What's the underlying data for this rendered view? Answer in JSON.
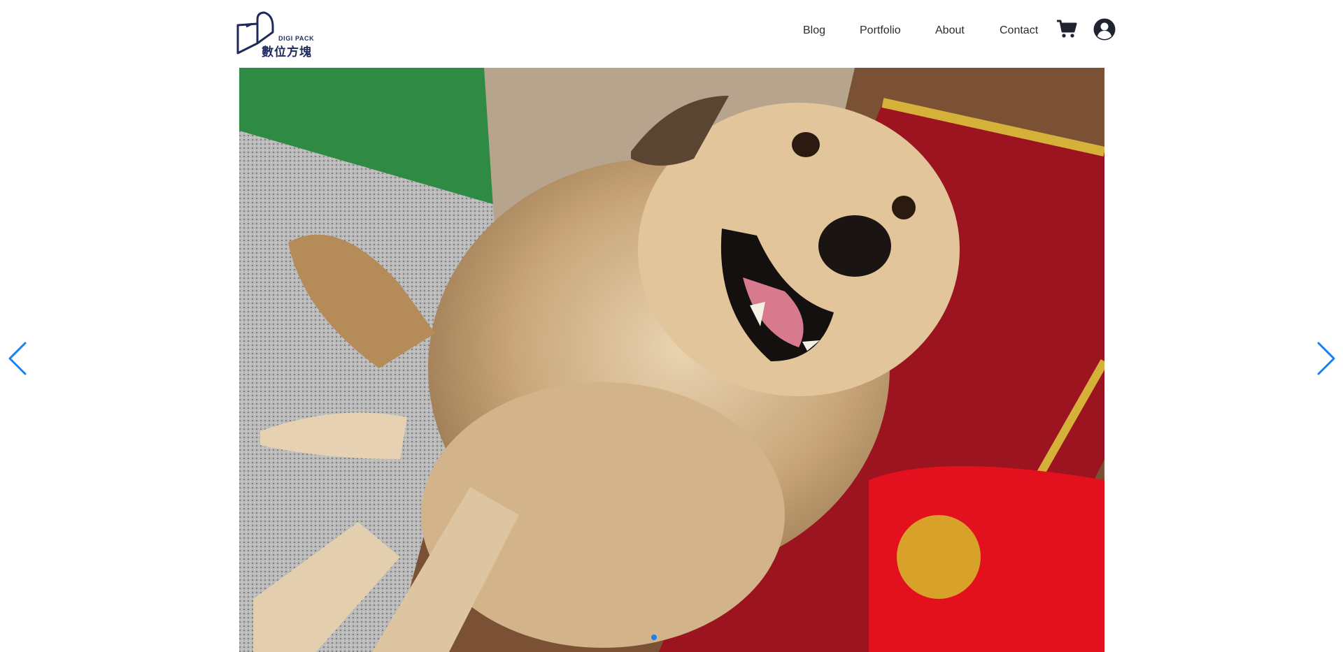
{
  "header": {
    "logo": {
      "name_en": "DIGI PACK",
      "name_zh": "數位方塊"
    },
    "nav": [
      {
        "label": "Blog"
      },
      {
        "label": "Portfolio"
      },
      {
        "label": "About"
      },
      {
        "label": "Contact"
      }
    ],
    "icons": {
      "cart": "shopping-cart-icon",
      "account": "user-circle-icon"
    }
  },
  "slider": {
    "image_alt": "Smiling tan dog sitting on a tiled floor next to red Chinese New Year decorations",
    "slide_count": 1,
    "current_slide": 1,
    "accent_color": "#1a7ff0",
    "icons": {
      "prev": "chevron-left-icon",
      "next": "chevron-right-icon"
    }
  }
}
